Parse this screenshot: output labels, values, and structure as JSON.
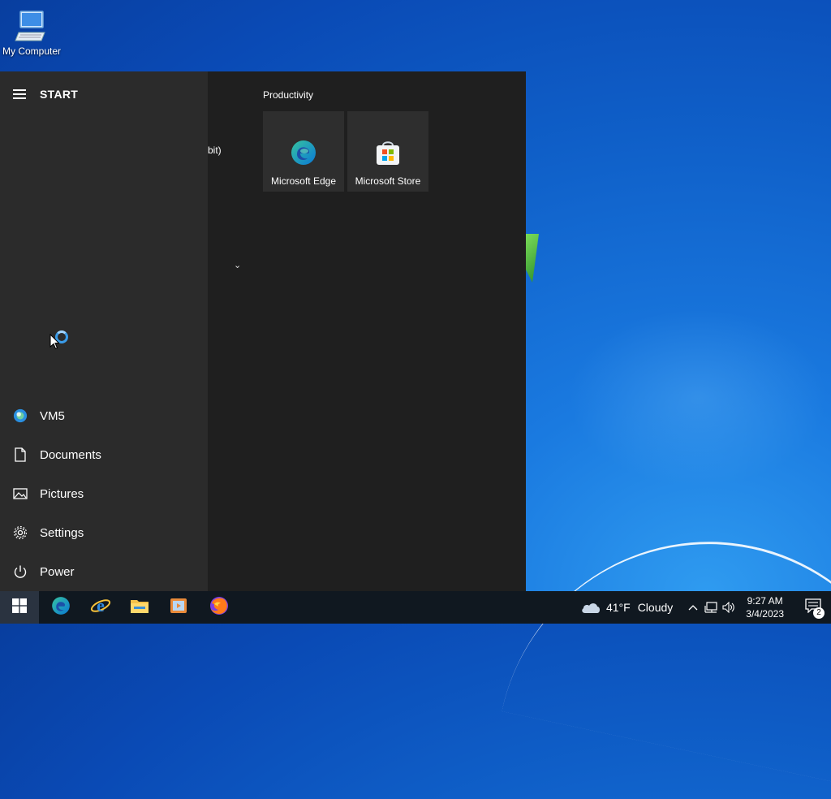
{
  "desktop": {
    "icons": [
      {
        "label": "My Computer",
        "icon": "computer-icon"
      }
    ]
  },
  "start_menu": {
    "title": "START",
    "partial_list_text": "bit)",
    "left_items": [
      {
        "label": "VM5",
        "icon": "user-avatar-icon"
      },
      {
        "label": "Documents",
        "icon": "document-icon"
      },
      {
        "label": "Pictures",
        "icon": "pictures-icon"
      },
      {
        "label": "Settings",
        "icon": "gear-icon"
      },
      {
        "label": "Power",
        "icon": "power-icon"
      }
    ],
    "tile_group": {
      "title": "Productivity",
      "tiles": [
        {
          "label": "Microsoft Edge",
          "icon": "edge-icon"
        },
        {
          "label": "Microsoft Store",
          "icon": "store-icon"
        }
      ]
    }
  },
  "taskbar": {
    "pinned": [
      {
        "name": "edge",
        "icon": "edge-icon"
      },
      {
        "name": "internet-explorer",
        "icon": "internet-explorer-icon"
      },
      {
        "name": "file-explorer",
        "icon": "folder-icon"
      },
      {
        "name": "media-player",
        "icon": "media-player-icon"
      },
      {
        "name": "firefox",
        "icon": "firefox-icon"
      }
    ],
    "weather": {
      "temp": "41°F",
      "condition": "Cloudy"
    },
    "clock": {
      "time": "9:27 AM",
      "date": "3/4/2023"
    },
    "notifications": {
      "count": "2"
    }
  },
  "colors": {
    "start_bg": "#1f1f1f",
    "start_left_bg": "#2b2b2b",
    "tile_bg": "#2e2e2e",
    "taskbar_bg": "#101820",
    "accent": "#0078d4"
  }
}
